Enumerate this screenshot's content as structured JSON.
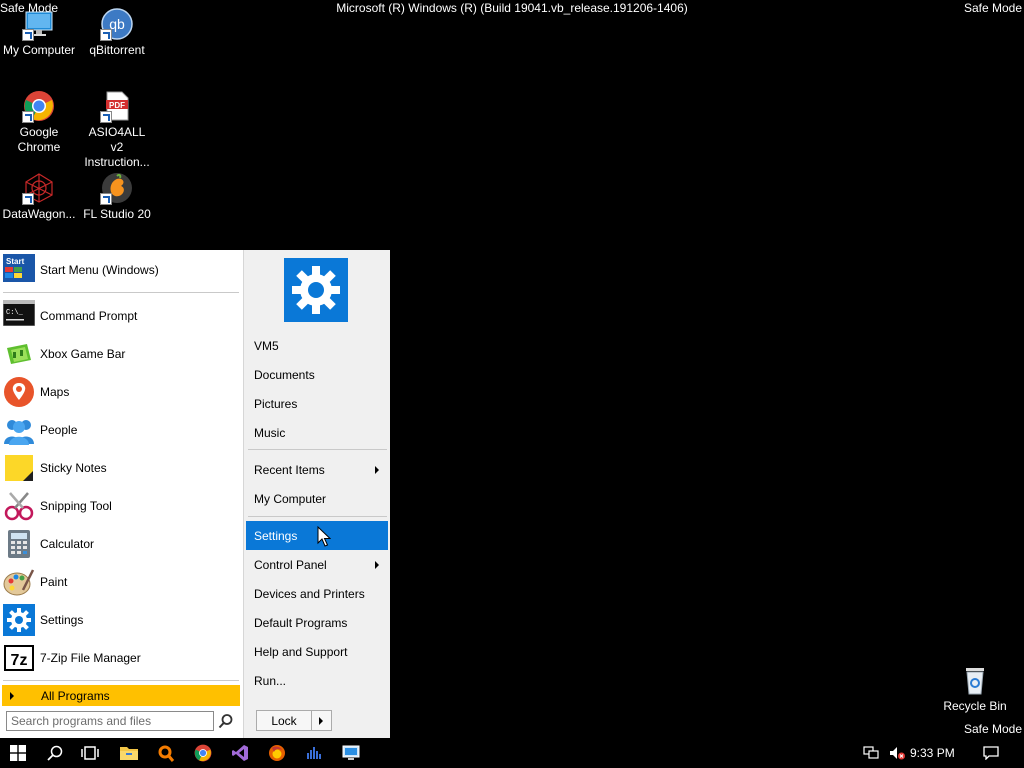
{
  "screen": {
    "safe_mode_label": "Safe Mode",
    "build_text": "Microsoft (R) Windows (R) (Build 19041.vb_release.191206-1406)"
  },
  "desktop": {
    "icons": [
      {
        "label": "My Computer",
        "icon": "computer-icon"
      },
      {
        "label": "qBittorrent",
        "icon": "qbittorrent-icon"
      },
      {
        "label": "Google Chrome",
        "icon": "chrome-icon"
      },
      {
        "label": "ASIO4ALL v2 Instruction...",
        "icon": "pdf-icon"
      },
      {
        "label": "DataWagon...",
        "icon": "datawagon-icon"
      },
      {
        "label": "FL Studio 20",
        "icon": "fl-studio-icon"
      },
      {
        "label": "Recycle Bin",
        "icon": "recycle-bin-icon"
      }
    ]
  },
  "start_menu": {
    "pinned": {
      "label": "Start Menu (Windows)",
      "icon": "start-menu-icon"
    },
    "programs": [
      {
        "label": "Command Prompt",
        "icon": "command-prompt-icon"
      },
      {
        "label": "Xbox Game Bar",
        "icon": "xbox-game-bar-icon"
      },
      {
        "label": "Maps",
        "icon": "maps-icon"
      },
      {
        "label": "People",
        "icon": "people-icon"
      },
      {
        "label": "Sticky Notes",
        "icon": "sticky-notes-icon"
      },
      {
        "label": "Snipping Tool",
        "icon": "snipping-tool-icon"
      },
      {
        "label": "Calculator",
        "icon": "calculator-icon"
      },
      {
        "label": "Paint",
        "icon": "paint-icon"
      },
      {
        "label": "Settings",
        "icon": "settings-icon"
      },
      {
        "label": "7-Zip File Manager",
        "icon": "7zip-icon"
      }
    ],
    "all_programs_label": "All Programs",
    "search_placeholder": "Search programs and files",
    "right_items": [
      {
        "label": "VM5"
      },
      {
        "label": "Documents"
      },
      {
        "label": "Pictures"
      },
      {
        "label": "Music"
      },
      {
        "label": "Recent Items",
        "submenu": true
      },
      {
        "label": "My Computer"
      },
      {
        "label": "Settings",
        "highlighted": true
      },
      {
        "label": "Control Panel",
        "submenu": true
      },
      {
        "label": "Devices and Printers"
      },
      {
        "label": "Default Programs"
      },
      {
        "label": "Help and Support"
      },
      {
        "label": "Run..."
      }
    ],
    "lock_label": "Lock"
  },
  "taskbar": {
    "buttons": [
      "start-button",
      "search-icon",
      "task-view-icon",
      "file-explorer-icon",
      "paint-app-icon",
      "chrome-icon",
      "visual-studio-icon",
      "firefox-icon",
      "fl-studio-icon",
      "remote-desktop-icon"
    ],
    "tray_icons": [
      "network-icon",
      "volume-muted-icon",
      "notifications-icon"
    ],
    "clock": "9:33 PM"
  },
  "colors": {
    "highlight": "#0a78d7",
    "all_programs": "#ffc000",
    "settings_tile": "#0a78d7"
  }
}
